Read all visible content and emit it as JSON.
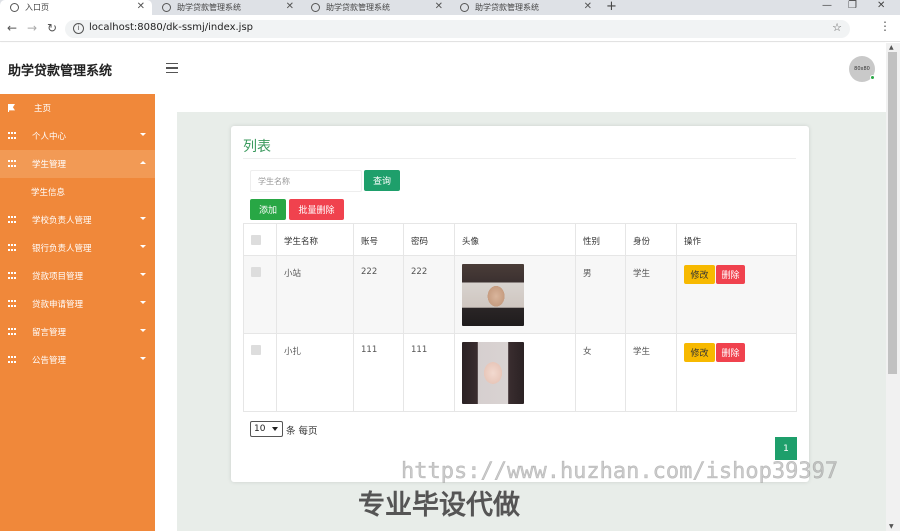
{
  "browser": {
    "tabs": [
      {
        "title": "入口页",
        "active": true
      },
      {
        "title": "助学贷款管理系统",
        "active": false
      },
      {
        "title": "助学贷款管理系统",
        "active": false
      },
      {
        "title": "助学贷款管理系统",
        "active": false
      }
    ],
    "new_tab": "+",
    "url": "localhost:8080/dk-ssmj/index.jsp"
  },
  "header": {
    "brand": "助学贷款管理系统",
    "avatar_text": "80x80"
  },
  "sidebar": {
    "items": [
      {
        "label": "主页",
        "icon": "flag-icon",
        "expand": "none"
      },
      {
        "label": "个人中心",
        "icon": "grid-icon",
        "expand": "down"
      },
      {
        "label": "学生管理",
        "icon": "grid-icon",
        "expand": "up",
        "active": true,
        "children": [
          "学生信息"
        ]
      },
      {
        "label": "学校负责人管理",
        "icon": "grid-icon",
        "expand": "down"
      },
      {
        "label": "银行负责人管理",
        "icon": "grid-icon",
        "expand": "down"
      },
      {
        "label": "贷款项目管理",
        "icon": "grid-icon",
        "expand": "down"
      },
      {
        "label": "贷款申请管理",
        "icon": "grid-icon",
        "expand": "down"
      },
      {
        "label": "留言管理",
        "icon": "grid-icon",
        "expand": "down"
      },
      {
        "label": "公告管理",
        "icon": "grid-icon",
        "expand": "down"
      }
    ]
  },
  "content": {
    "title": "列表",
    "search_placeholder": "学生名称",
    "query_label": "查询",
    "add_label": "添加",
    "batch_delete_label": "批量删除",
    "columns": [
      "学生名称",
      "账号",
      "密码",
      "头像",
      "性别",
      "身份",
      "操作"
    ],
    "rows": [
      {
        "name": "小站",
        "account": "222",
        "password": "222",
        "gender": "男",
        "role": "学生"
      },
      {
        "name": "小扎",
        "account": "111",
        "password": "111",
        "gender": "女",
        "role": "学生"
      }
    ],
    "edit_label": "修改",
    "delete_label": "删除",
    "page_size": "10",
    "page_size_suffix": "条 每页",
    "current_page": "1"
  },
  "watermark": {
    "url_text": "https://www.huzhan.com/ishop39397",
    "slogan": "专业毕设代做"
  },
  "colors": {
    "sidebar": "#f0883a",
    "primary_green": "#1e9f6b",
    "danger": "#f0424e",
    "warning": "#f7b900",
    "title_green": "#3b9a5e"
  }
}
